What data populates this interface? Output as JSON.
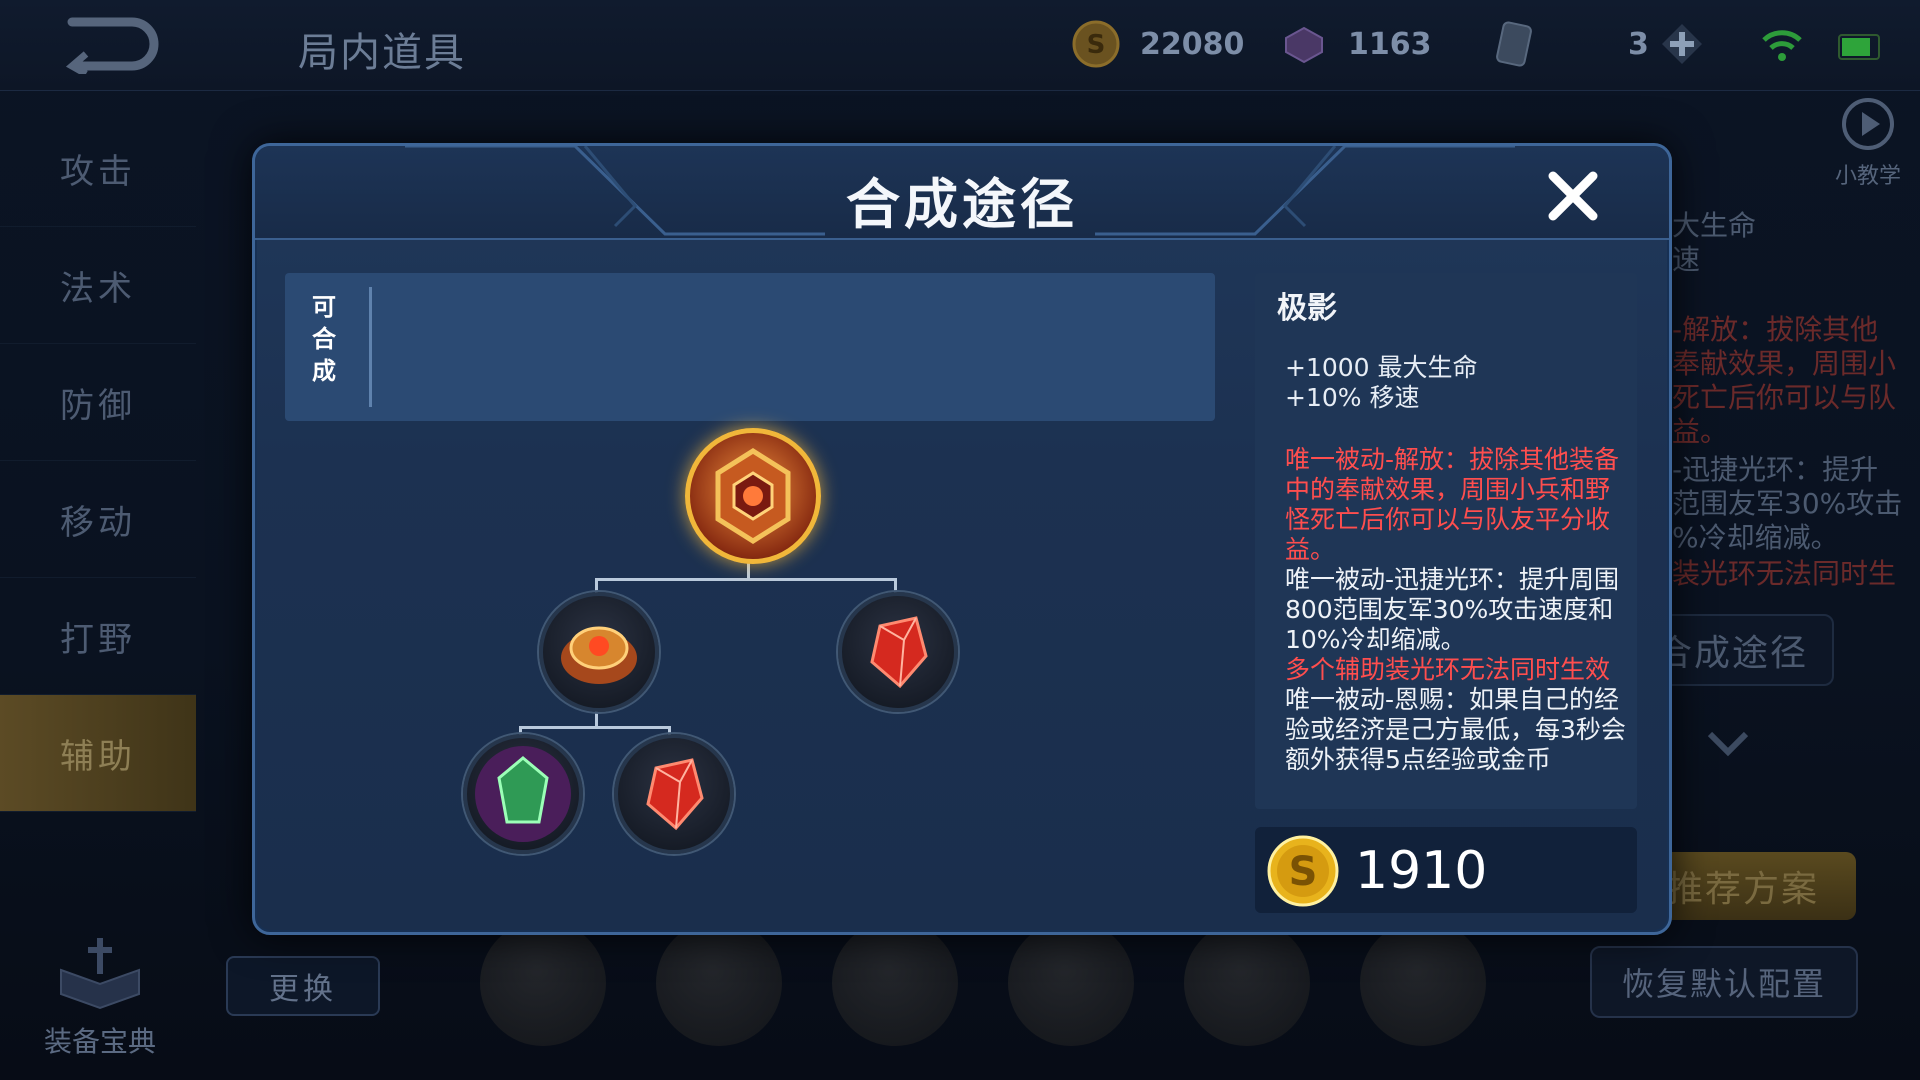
{
  "topbar": {
    "title": "局内道具",
    "gold_coins": "22080",
    "gems": "1163",
    "tickets": "3"
  },
  "sidebar": {
    "items": [
      {
        "label": "攻击"
      },
      {
        "label": "法术"
      },
      {
        "label": "防御"
      },
      {
        "label": "移动"
      },
      {
        "label": "打野"
      },
      {
        "label": "辅助"
      }
    ],
    "active": "辅助",
    "codex_label": "装备宝典"
  },
  "bottom": {
    "swap_label": "更换"
  },
  "right_panel": {
    "tutorial_label": "小教学",
    "ghost_lines": [
      "大生命",
      "速",
      "-解放：拔除其他",
      "奉献效果，周围小",
      "死亡后你可以与队",
      "益。",
      "-迅捷光环：提升",
      "范围友军30%攻击",
      "%冷却缩减。",
      "装光环无法同时生"
    ],
    "synth_path_label": "合成途径",
    "recommend_label": "推荐方案",
    "restore_label": "恢复默认配置"
  },
  "modal": {
    "title": "合成途径",
    "craftable_tag": "可合成",
    "item": {
      "name": "极影",
      "stats": [
        "+1000 最大生命",
        "+10% 移速"
      ],
      "passive1": "唯一被动-解放：拔除其他装备中的奉献效果，周围小兵和野怪死亡后你可以与队友平分收益。",
      "passive2": "唯一被动-迅捷光环：提升周围800范围友军30%攻击速度和10%冷却缩减。",
      "warning": "多个辅助装光环无法同时生效",
      "passive3": "唯一被动-恩赐：如果自己的经验或经济是己方最低，每3秒会额外获得5点经验或金币"
    },
    "price": "1910"
  },
  "colors": {
    "accent_gold": "#f1b73a",
    "passive_red": "#ff4e4e",
    "modal_bg": "#1c3151"
  }
}
